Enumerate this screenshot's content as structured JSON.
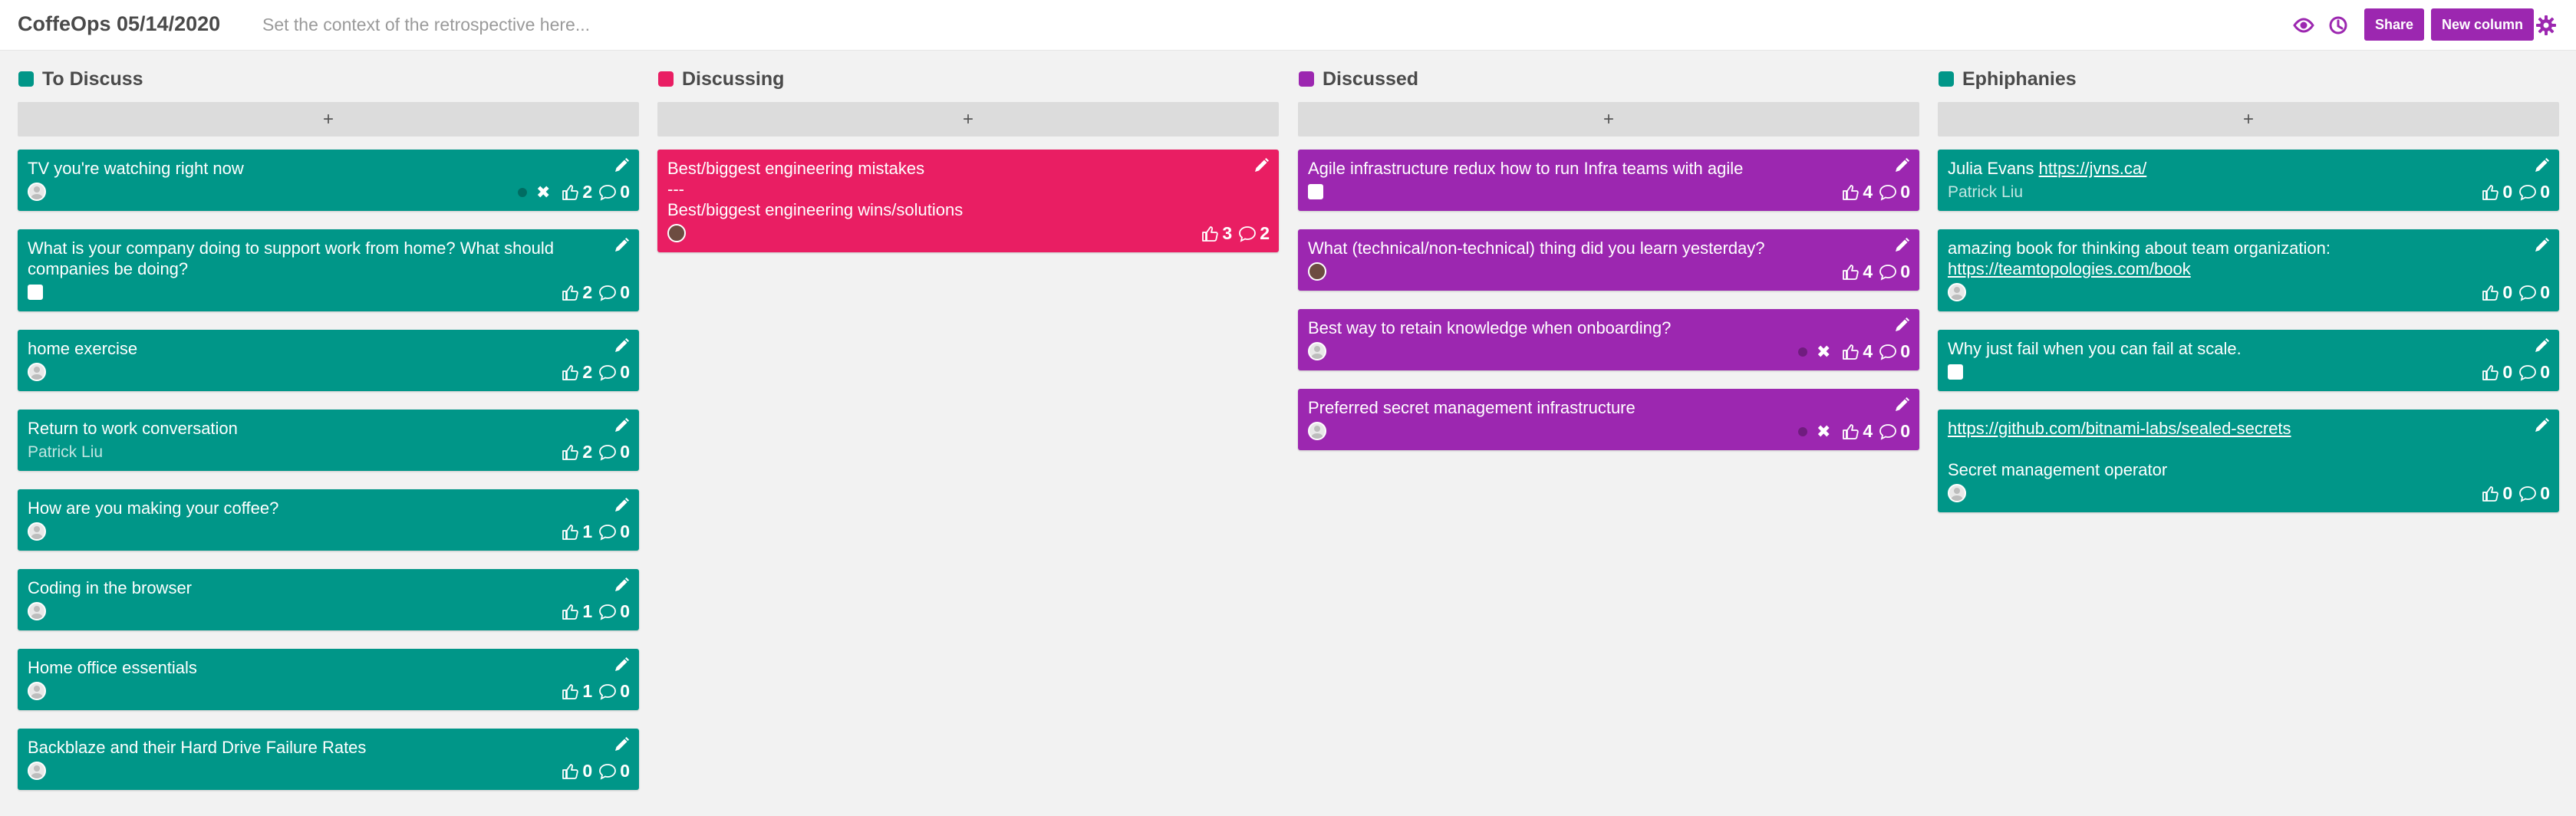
{
  "header": {
    "title": "CoffeOps 05/14/2020",
    "context_placeholder": "Set the context of the retrospective here...",
    "share_label": "Share",
    "new_column_label": "New column",
    "accent_color": "#9c27b0"
  },
  "add_label": "+",
  "columns": [
    {
      "title": "To Discuss",
      "color": "#009688",
      "cards": [
        {
          "text": "TV you're watching right now",
          "avatar": "person",
          "likes": "2",
          "comments": "0",
          "vote_ui": true
        },
        {
          "text": "What is your company doing to support work from home? What should companies be doing?",
          "avatar": "square",
          "likes": "2",
          "comments": "0"
        },
        {
          "text": "home exercise",
          "avatar": "person",
          "likes": "2",
          "comments": "0"
        },
        {
          "text": "Return to work conversation",
          "author": "Patrick Liu",
          "likes": "2",
          "comments": "0"
        },
        {
          "text": "How are you making your coffee?",
          "avatar": "person",
          "likes": "1",
          "comments": "0"
        },
        {
          "text": "Coding in the browser",
          "avatar": "person",
          "likes": "1",
          "comments": "0"
        },
        {
          "text": "Home office essentials",
          "avatar": "person",
          "likes": "1",
          "comments": "0"
        },
        {
          "text": "Backblaze and their Hard Drive Failure Rates",
          "avatar": "photo",
          "likes": "0",
          "comments": "0"
        }
      ]
    },
    {
      "title": "Discussing",
      "color": "#e91e63",
      "cards": [
        {
          "text": "Best/biggest engineering mistakes\n---\nBest/biggest engineering wins/solutions",
          "avatar": "photo-dark",
          "likes": "3",
          "comments": "2"
        }
      ]
    },
    {
      "title": "Discussed",
      "color": "#9c27b0",
      "cards": [
        {
          "text": "Agile infrastructure redux how to run Infra teams with agile",
          "avatar": "square",
          "likes": "4",
          "comments": "0"
        },
        {
          "text": "What (technical/non-technical) thing did you learn yesterday?",
          "avatar": "photo-dark",
          "likes": "4",
          "comments": "0"
        },
        {
          "text": "Best way to retain knowledge when onboarding?",
          "avatar": "photo",
          "likes": "4",
          "comments": "0",
          "vote_ui": true
        },
        {
          "text": "Preferred secret management infrastructure",
          "avatar": "person",
          "likes": "4",
          "comments": "0",
          "vote_ui": true
        }
      ]
    },
    {
      "title": "Ephiphanies",
      "color": "#009688",
      "cards": [
        {
          "text": "Julia Evans ",
          "link": "https://jvns.ca/",
          "author": "Patrick Liu",
          "likes": "0",
          "comments": "0"
        },
        {
          "text": "amazing book for thinking about team organization:\n",
          "link": "https://teamtopologies.com/book",
          "avatar": "person",
          "likes": "0",
          "comments": "0"
        },
        {
          "text": "Why just fail when you can fail at scale.",
          "avatar": "square",
          "likes": "0",
          "comments": "0"
        },
        {
          "text": "",
          "link": "https://github.com/bitnami-labs/sealed-secrets",
          "text_after": "\n\nSecret management operator",
          "avatar": "person",
          "likes": "0",
          "comments": "0"
        }
      ]
    }
  ],
  "icons": {
    "eye": "eye-icon",
    "history": "history-icon",
    "settings": "gear-icon",
    "edit": "pencil-icon",
    "like": "thumbs-up-icon",
    "comment": "comment-icon",
    "avatar": "avatar-icon",
    "remove": "close-icon"
  }
}
